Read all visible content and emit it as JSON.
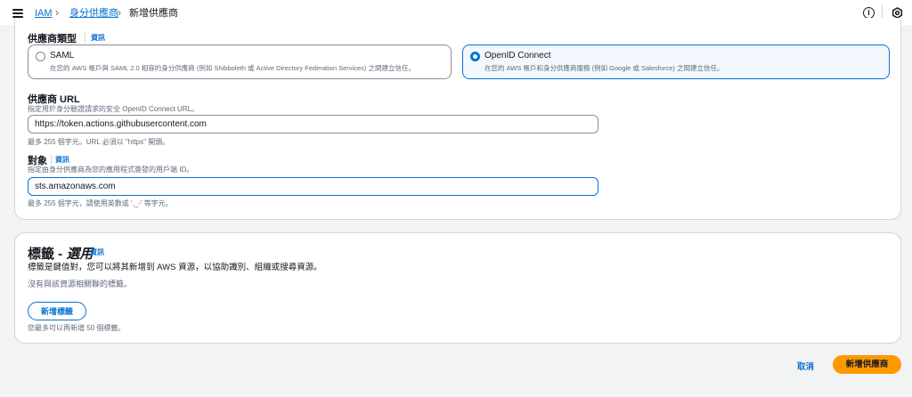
{
  "breadcrumb": {
    "items": [
      "IAM",
      "身分供應商",
      "新增供應商"
    ]
  },
  "provider_type": {
    "label": "供應商類型",
    "info": "資訊",
    "options": [
      {
        "title": "SAML",
        "description": "在您的 AWS 帳戶與 SAML 2.0 相容的身分供應商 (例如 Shibboleth 或 Active Directory Federation Services) 之間建立信任。",
        "selected": false
      },
      {
        "title": "OpenID Connect",
        "description": "在您的 AWS 帳戶和身分供應商服務 (例如 Google 或 Salesforce) 之間建立信任。",
        "selected": true
      }
    ]
  },
  "provider_url": {
    "label": "供應商 URL",
    "description": "指定用於身分驗證請求的安全 OpenID Connect URL。",
    "value": "https://token.actions.githubusercontent.com",
    "constraint": "最多 255 個字元。URL 必須以 \"https\" 開頭。"
  },
  "audience": {
    "label": "對象",
    "info": "資訊",
    "description": "指定由身分供應商為您的應用程式簽發的用戶端 ID。",
    "value": "sts.amazonaws.com",
    "constraint": "最多 255 個字元，請使用英數或 '._-' 等字元。"
  },
  "tags": {
    "title": "標籤 - ",
    "title_optional": "選用",
    "info": "資訊",
    "description": "標籤是鍵值對，您可以將其新增到 AWS 資源，以協助識別、組織或搜尋資源。",
    "empty_text": "沒有與該資源相關聯的標籤。",
    "add_button": "新增標籤",
    "limit_text": "您最多可以再新增 50 個標籤。"
  },
  "footer": {
    "cancel": "取消",
    "submit": "新增供應商"
  },
  "colors": {
    "accent": "#0972d3",
    "primary_button": "#ff9900",
    "background": "#f2f3f3"
  },
  "icons": {
    "menu": "hamburger-menu-icon",
    "info": "info-icon",
    "settings": "settings-icon"
  }
}
